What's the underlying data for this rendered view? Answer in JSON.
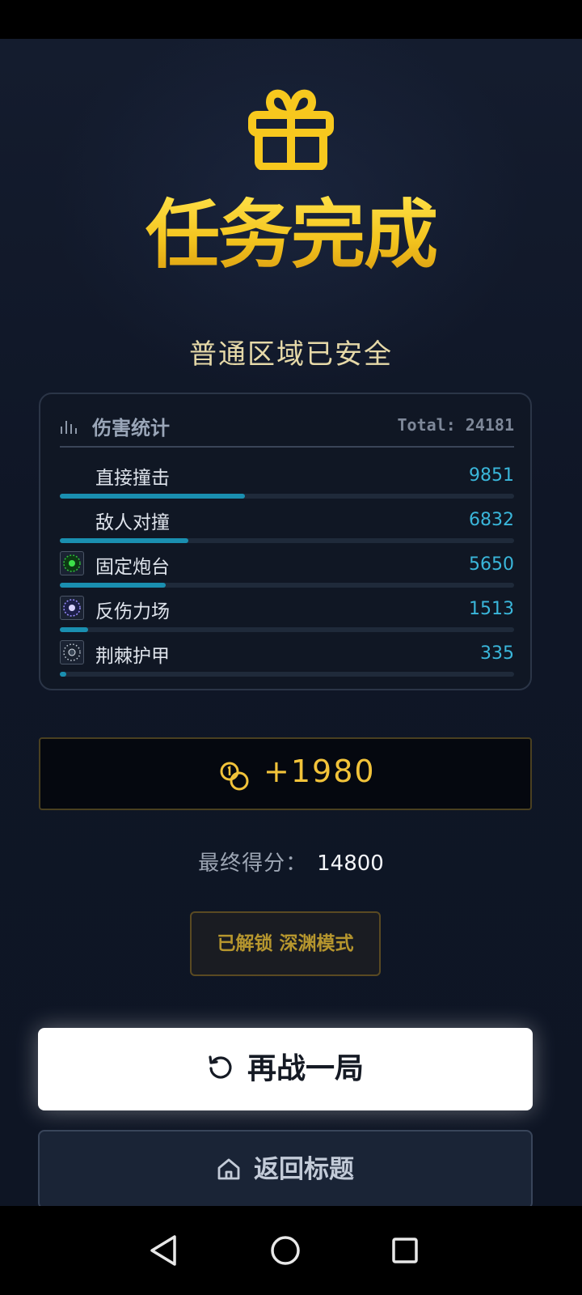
{
  "result": {
    "title": "任务完成",
    "subtitle": "普通区域已安全"
  },
  "damage_stats": {
    "title": "伤害统计",
    "total_label": "Total: 24181",
    "total": 24181,
    "items": [
      {
        "name": "直接撞击",
        "value": "9851",
        "amount": 9851,
        "has_icon": false
      },
      {
        "name": "敌人对撞",
        "value": "6832",
        "amount": 6832,
        "has_icon": false
      },
      {
        "name": "固定炮台",
        "value": "5650",
        "amount": 5650,
        "has_icon": true,
        "icon": "turret-icon"
      },
      {
        "name": "反伤力场",
        "value": "1513",
        "amount": 1513,
        "has_icon": true,
        "icon": "force-field-icon"
      },
      {
        "name": "荆棘护甲",
        "value": "335",
        "amount": 335,
        "has_icon": true,
        "icon": "thorn-armor-icon"
      }
    ]
  },
  "reward": {
    "coins": "+1980",
    "icon": "coins-icon"
  },
  "score": {
    "label": "最终得分：",
    "value": "14800"
  },
  "unlock": {
    "text": "已解锁 深渊模式"
  },
  "buttons": {
    "retry_label": "再战一局",
    "retry_icon": "refresh-icon",
    "home_label": "返回标题",
    "home_icon": "home-icon"
  },
  "colors": {
    "accent_gold": "#f3c41e",
    "bar_fill": "#1a8fb0",
    "value_cyan": "#3ab6da"
  }
}
